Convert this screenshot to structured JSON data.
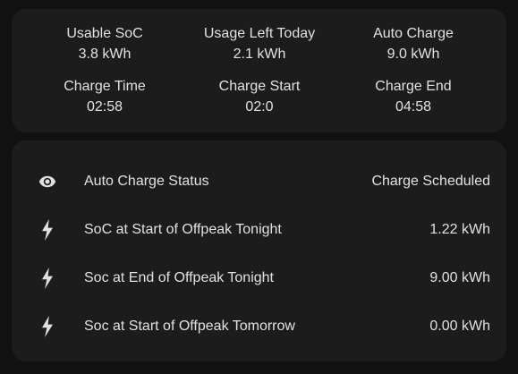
{
  "summary": {
    "stats": [
      {
        "name": "Usable SoC",
        "value": "3.8 kWh"
      },
      {
        "name": "Usage Left Today",
        "value": "2.1 kWh"
      },
      {
        "name": "Auto Charge",
        "value": "9.0 kWh"
      },
      {
        "name": "Charge Time",
        "value": "02:58"
      },
      {
        "name": "Charge Start",
        "value": "02:0"
      },
      {
        "name": "Charge End",
        "value": "04:58"
      }
    ]
  },
  "entities": {
    "rows": [
      {
        "icon": "eye-icon",
        "label": "Auto Charge Status",
        "state": "Charge Scheduled"
      },
      {
        "icon": "flash-icon",
        "label": "SoC at Start of Offpeak Tonight",
        "state": "1.22 kWh"
      },
      {
        "icon": "flash-icon",
        "label": "Soc at End of Offpeak Tonight",
        "state": "9.00 kWh"
      },
      {
        "icon": "flash-icon",
        "label": "Soc at Start of Offpeak Tomorrow",
        "state": "0.00 kWh"
      }
    ]
  },
  "colors": {
    "background": "#111111",
    "card": "#1c1c1c",
    "text": "#e1e1e1",
    "icon": "#e1e1e1"
  }
}
